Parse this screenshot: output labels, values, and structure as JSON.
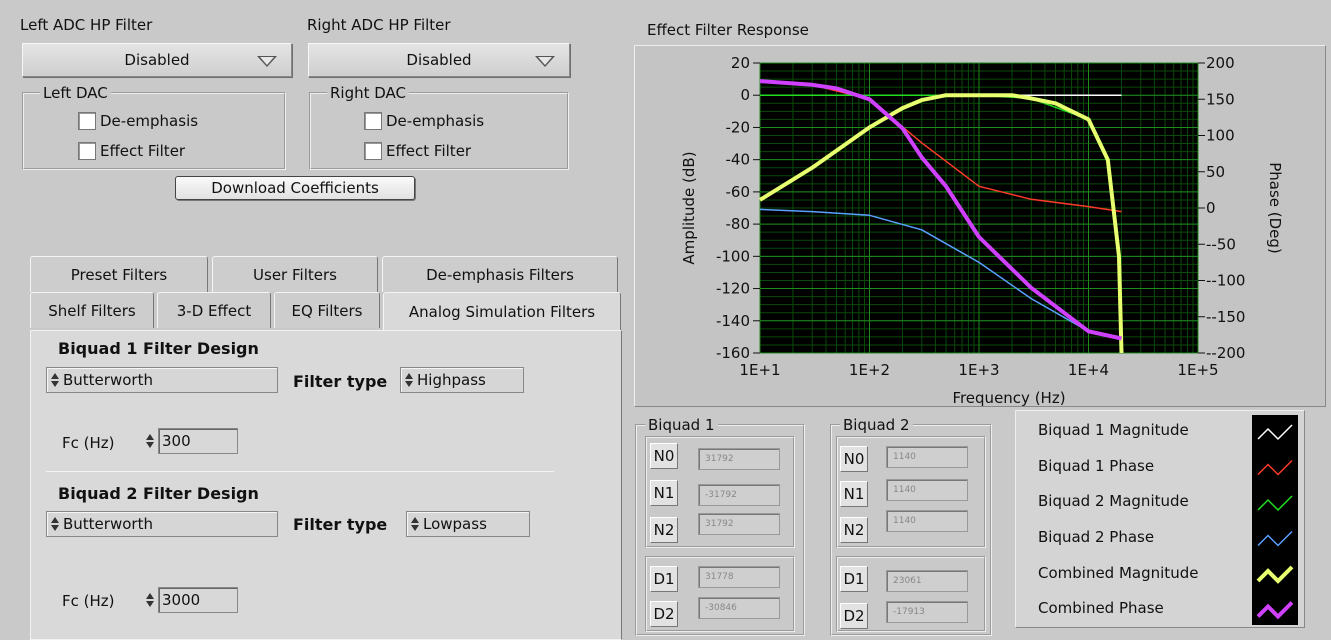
{
  "left_adc": {
    "label": "Left ADC HP Filter",
    "value": "Disabled"
  },
  "right_adc": {
    "label": "Right ADC HP Filter",
    "value": "Disabled"
  },
  "left_dac": {
    "title": "Left DAC",
    "deemphasis": "De-emphasis",
    "effect": "Effect Filter"
  },
  "right_dac": {
    "title": "Right DAC",
    "deemphasis": "De-emphasis",
    "effect": "Effect Filter"
  },
  "download_button": "Download Coefficients",
  "tabs": {
    "row1": [
      "Preset Filters",
      "User Filters",
      "De-emphasis Filters"
    ],
    "row2": [
      "Shelf Filters",
      "3-D Effect",
      "EQ Filters",
      "Analog Simulation Filters"
    ]
  },
  "biquad1": {
    "title": "Biquad 1 Filter Design",
    "design": "Butterworth",
    "filter_type_label": "Filter type",
    "filter_type": "Highpass",
    "fc_label": "Fc (Hz)",
    "fc": "300"
  },
  "biquad2": {
    "title": "Biquad 2 Filter Design",
    "design": "Butterworth",
    "filter_type_label": "Filter type",
    "filter_type": "Lowpass",
    "fc_label": "Fc (Hz)",
    "fc": "3000"
  },
  "coef1": {
    "title": "Biquad 1",
    "labels": [
      "N0",
      "N1",
      "N2",
      "D1",
      "D2"
    ],
    "values": [
      "31792",
      "-31792",
      "31792",
      "31778",
      "-30846"
    ]
  },
  "coef2": {
    "title": "Biquad 2",
    "labels": [
      "N0",
      "N1",
      "N2",
      "D1",
      "D2"
    ],
    "values": [
      "1140",
      "1140",
      "1140",
      "23061",
      "-17913"
    ]
  },
  "legend": {
    "items": [
      {
        "label": "Biquad 1 Magnitude",
        "color": "#ffffff"
      },
      {
        "label": "Biquad 1 Phase",
        "color": "#ff3a2a"
      },
      {
        "label": "Biquad 2 Magnitude",
        "color": "#22dd22"
      },
      {
        "label": "Biquad 2 Phase",
        "color": "#5aa0ff"
      },
      {
        "label": "Combined Magnitude",
        "color": "#e8ff70"
      },
      {
        "label": "Combined Phase",
        "color": "#d040ff"
      }
    ]
  },
  "chart_data": {
    "type": "line",
    "title": "Effect Filter Response",
    "xlabel": "Frequency (Hz)",
    "ylabel": "Amplitude (dB)",
    "y2label": "Phase (Deg)",
    "xscale": "log",
    "xlim": [
      10,
      100000
    ],
    "ylim": [
      -160,
      20
    ],
    "y2lim": [
      -200,
      200
    ],
    "x_ticks": [
      "1E+1",
      "1E+2",
      "1E+3",
      "1E+4",
      "1E+5"
    ],
    "y_ticks": [
      "20",
      "0",
      "-20",
      "-40",
      "-60",
      "-80",
      "-100",
      "-120",
      "-140",
      "-160"
    ],
    "y2_ticks": [
      "200",
      "150",
      "100",
      "50",
      "0",
      "-50",
      "-100",
      "-150",
      "-200"
    ],
    "grid": true,
    "series": [
      {
        "name": "Biquad 1 Magnitude",
        "axis": "left",
        "x": [
          10,
          30,
          100,
          300,
          1000,
          3000,
          10000,
          20000
        ],
        "y": [
          0,
          0,
          0,
          0,
          0,
          0,
          0,
          0
        ]
      },
      {
        "name": "Biquad 1 Phase",
        "axis": "right",
        "x": [
          10,
          30,
          100,
          300,
          1000,
          3000,
          10000,
          20000
        ],
        "y": [
          175,
          170,
          150,
          90,
          30,
          12,
          2,
          -5
        ]
      },
      {
        "name": "Biquad 2 Magnitude",
        "axis": "left",
        "x": [
          10,
          100,
          300,
          1000,
          3000,
          10000,
          15000,
          19000,
          20000
        ],
        "y": [
          0,
          0,
          0,
          0,
          -2,
          -15,
          -40,
          -100,
          -160
        ]
      },
      {
        "name": "Biquad 2 Phase",
        "axis": "right",
        "x": [
          10,
          30,
          100,
          300,
          1000,
          3000,
          10000,
          20000
        ],
        "y": [
          -2,
          -5,
          -10,
          -30,
          -75,
          -125,
          -170,
          -180
        ]
      },
      {
        "name": "Combined Magnitude",
        "axis": "left",
        "x": [
          10,
          30,
          100,
          200,
          300,
          500,
          1000,
          2000,
          3000,
          5000,
          10000,
          15000,
          19000,
          20000
        ],
        "y": [
          -65,
          -45,
          -20,
          -8,
          -3,
          0,
          0,
          0,
          -2,
          -5,
          -15,
          -40,
          -100,
          -160
        ]
      },
      {
        "name": "Combined Phase",
        "axis": "right",
        "x": [
          10,
          30,
          50,
          100,
          200,
          300,
          500,
          1000,
          3000,
          10000,
          20000
        ],
        "y": [
          175,
          170,
          165,
          150,
          110,
          70,
          30,
          -40,
          -110,
          -170,
          -180
        ]
      }
    ]
  }
}
